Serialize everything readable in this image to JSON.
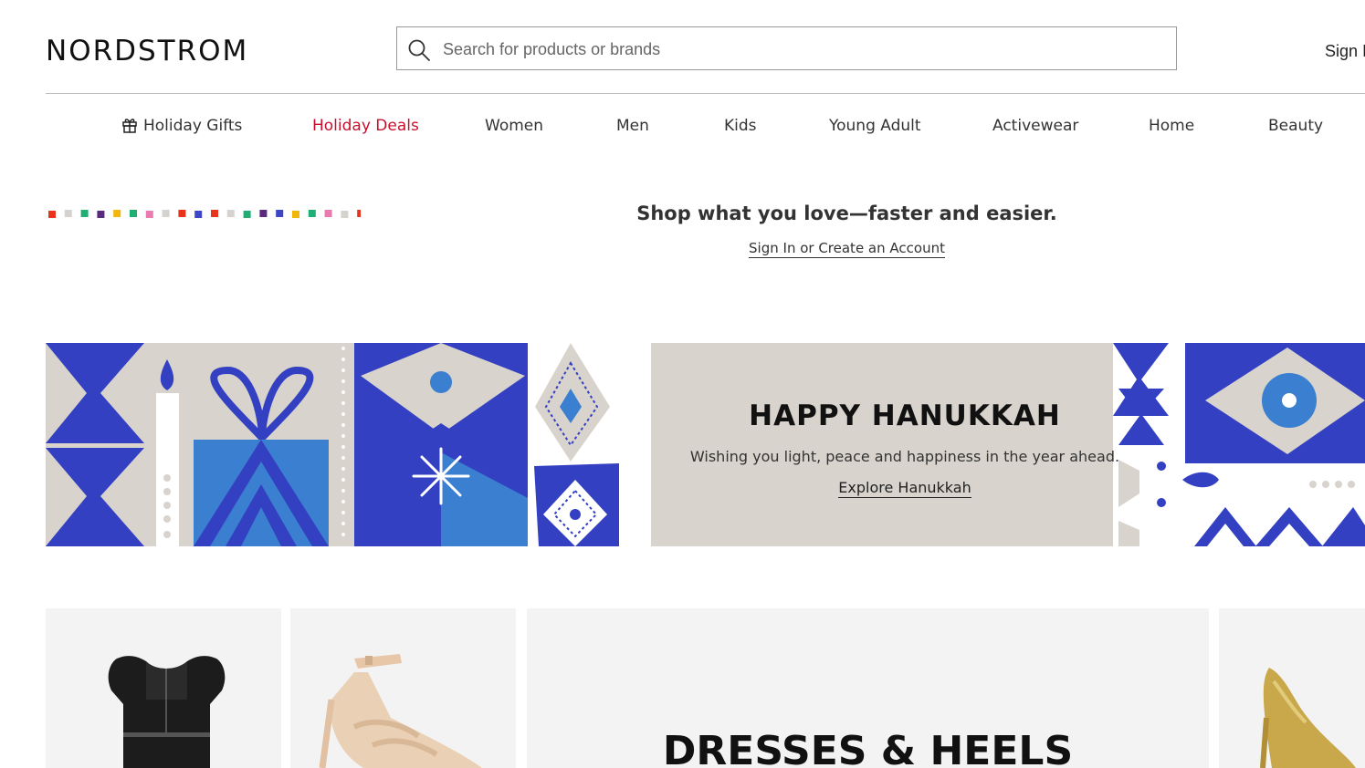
{
  "brand": {
    "logo_text": "NORDSTROM"
  },
  "search": {
    "placeholder": "Search for products or brands",
    "icon": "search-icon"
  },
  "header": {
    "sign_in_label": "Sign In"
  },
  "nav": {
    "items": [
      {
        "label": "Holiday Gifts",
        "icon": "gift-icon"
      },
      {
        "label": "Holiday Deals",
        "accent": "#c8102e"
      },
      {
        "label": "Women"
      },
      {
        "label": "Men"
      },
      {
        "label": "Kids"
      },
      {
        "label": "Young Adult"
      },
      {
        "label": "Activewear"
      },
      {
        "label": "Home"
      },
      {
        "label": "Beauty"
      }
    ]
  },
  "promo": {
    "headline": "Shop what you love—faster and easier.",
    "link": "Sign In or Create an Account",
    "confetti_colors": [
      "#e8341c",
      "#d6d3ce",
      "#1fae74",
      "#5a2a7e",
      "#f2b70a",
      "#1fae74",
      "#e97bb0",
      "#d6d3ce",
      "#e8341c",
      "#3b47c4",
      "#e8341c",
      "#d6d3ce",
      "#1fae74",
      "#5a2a7e",
      "#3b47c4",
      "#f2b70a",
      "#1fae74",
      "#e97bb0",
      "#d6d3ce",
      "#e8341c"
    ]
  },
  "banner": {
    "title": "HAPPY HANUKKAH",
    "subtitle": "Wishing you light, peace and happiness in the year ahead.",
    "link": "Explore Hanukkah",
    "colors": {
      "blue": "#3340c2",
      "light_blue": "#3b7fd0",
      "background": "#d8d3cc",
      "white": "#ffffff"
    }
  },
  "tiles": {
    "heading": "DRESSES & HEELS",
    "items": [
      {
        "name": "black-lace-dress"
      },
      {
        "name": "nude-strappy-sandal"
      },
      {
        "name": "dresses-heels-feature"
      },
      {
        "name": "gold-pump"
      }
    ]
  }
}
